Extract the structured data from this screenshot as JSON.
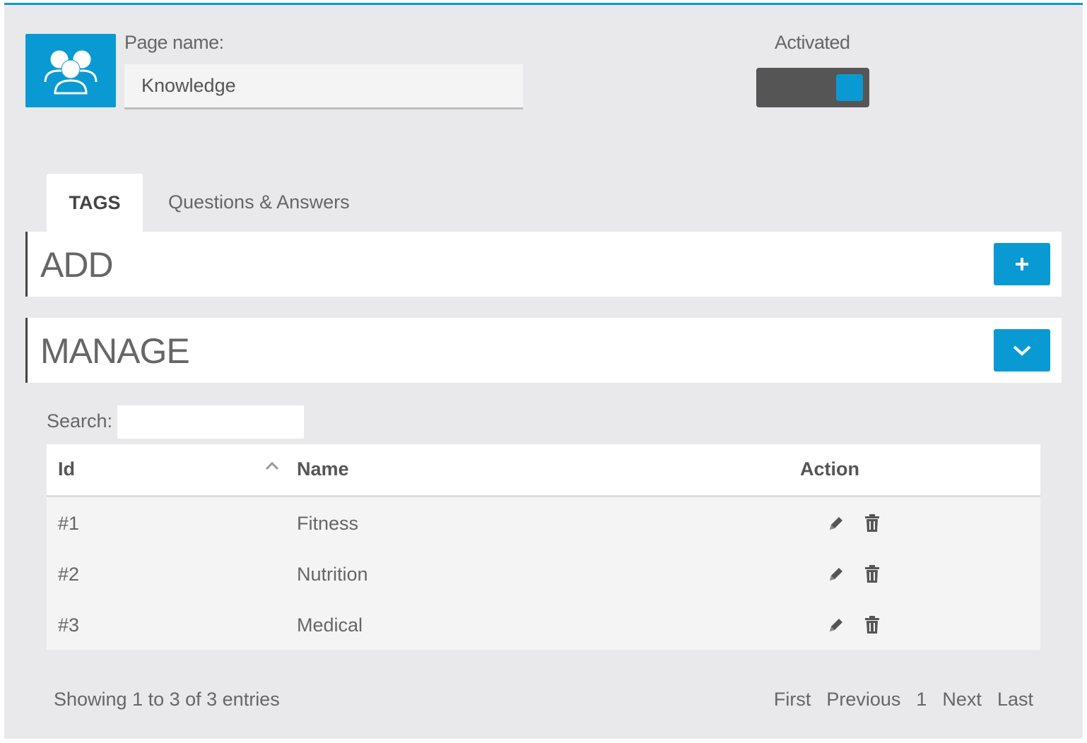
{
  "header": {
    "page_name_label": "Page name:",
    "page_name_value": "Knowledge",
    "activated_label": "Activated",
    "activated": true,
    "icon": "users-group-icon"
  },
  "tabs": [
    {
      "label": "TAGS",
      "active": true
    },
    {
      "label": "Questions & Answers",
      "active": false
    }
  ],
  "panels": {
    "add": {
      "title": "ADD",
      "button_icon": "plus-icon"
    },
    "manage": {
      "title": "MANAGE",
      "button_icon": "chevron-down-icon"
    }
  },
  "search": {
    "label": "Search:",
    "value": ""
  },
  "table": {
    "columns": [
      "Id",
      "Name",
      "Action"
    ],
    "sort_column": "Id",
    "rows": [
      {
        "id": "#1",
        "name": "Fitness"
      },
      {
        "id": "#2",
        "name": "Nutrition"
      },
      {
        "id": "#3",
        "name": "Medical"
      }
    ],
    "row_actions": [
      "pencil-icon",
      "trash-icon"
    ]
  },
  "footer": {
    "info": "Showing 1 to 3 of 3 entries",
    "pager": [
      "First",
      "Previous",
      "1",
      "Next",
      "Last"
    ]
  },
  "colors": {
    "accent": "#0a9ad3",
    "toggle_track": "#555555",
    "background": "#e9e9eb"
  }
}
